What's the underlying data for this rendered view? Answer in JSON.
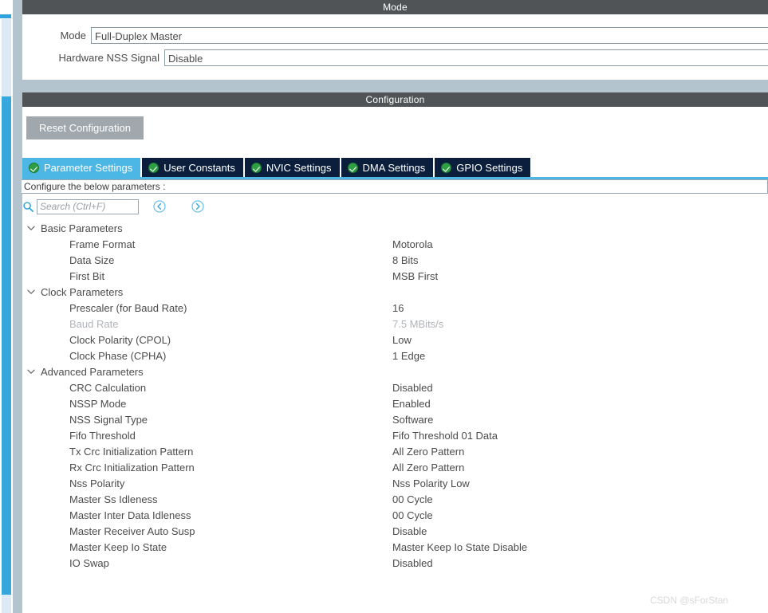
{
  "left_rail": {
    "scrollbar_name": "vertical-scrollbar",
    "accent_color": "#36a8de"
  },
  "mode_panel": {
    "title": "Mode",
    "fields": [
      {
        "label": "Mode",
        "value": "Full-Duplex Master"
      },
      {
        "label": "Hardware NSS Signal",
        "value": "Disable"
      }
    ]
  },
  "config_panel": {
    "title": "Configuration",
    "reset_label": "Reset Configuration",
    "tabs": [
      {
        "label": "Parameter Settings",
        "active": true
      },
      {
        "label": "User Constants",
        "active": false
      },
      {
        "label": "NVIC Settings",
        "active": false
      },
      {
        "label": "DMA Settings",
        "active": false
      },
      {
        "label": "GPIO Settings",
        "active": false
      }
    ],
    "configure_text": "Configure the below parameters :",
    "search": {
      "placeholder": "Search (Ctrl+F)",
      "value": "",
      "prev_icon": "chevron-left-circle-icon",
      "next_icon": "chevron-right-circle-icon"
    },
    "groups": [
      {
        "label": "Basic Parameters",
        "expanded": true,
        "rows": [
          {
            "name": "Frame Format",
            "value": "Motorola",
            "dim": false
          },
          {
            "name": "Data Size",
            "value": "8 Bits",
            "dim": false
          },
          {
            "name": "First Bit",
            "value": "MSB First",
            "dim": false
          }
        ]
      },
      {
        "label": "Clock Parameters",
        "expanded": true,
        "rows": [
          {
            "name": "Prescaler (for Baud Rate)",
            "value": "16",
            "dim": false
          },
          {
            "name": "Baud Rate",
            "value": "7.5 MBits/s",
            "dim": true
          },
          {
            "name": "Clock Polarity (CPOL)",
            "value": "Low",
            "dim": false
          },
          {
            "name": "Clock Phase (CPHA)",
            "value": "1 Edge",
            "dim": false
          }
        ]
      },
      {
        "label": "Advanced Parameters",
        "expanded": true,
        "rows": [
          {
            "name": "CRC Calculation",
            "value": "Disabled",
            "dim": false
          },
          {
            "name": "NSSP Mode",
            "value": "Enabled",
            "dim": false
          },
          {
            "name": "NSS Signal Type",
            "value": "Software",
            "dim": false
          },
          {
            "name": "Fifo Threshold",
            "value": "Fifo Threshold 01 Data",
            "dim": false
          },
          {
            "name": "Tx Crc Initialization Pattern",
            "value": "All Zero Pattern",
            "dim": false
          },
          {
            "name": "Rx Crc Initialization Pattern",
            "value": "All Zero Pattern",
            "dim": false
          },
          {
            "name": "Nss Polarity",
            "value": "Nss Polarity Low",
            "dim": false
          },
          {
            "name": "Master Ss Idleness",
            "value": "00 Cycle",
            "dim": false
          },
          {
            "name": "Master Inter Data Idleness",
            "value": "00 Cycle",
            "dim": false
          },
          {
            "name": "Master Receiver Auto Susp",
            "value": "Disable",
            "dim": false
          },
          {
            "name": "Master Keep Io State",
            "value": "Master Keep Io State Disable",
            "dim": false
          },
          {
            "name": "IO Swap",
            "value": "Disabled",
            "dim": false
          }
        ]
      }
    ]
  },
  "watermark": "CSDN @sForStan"
}
